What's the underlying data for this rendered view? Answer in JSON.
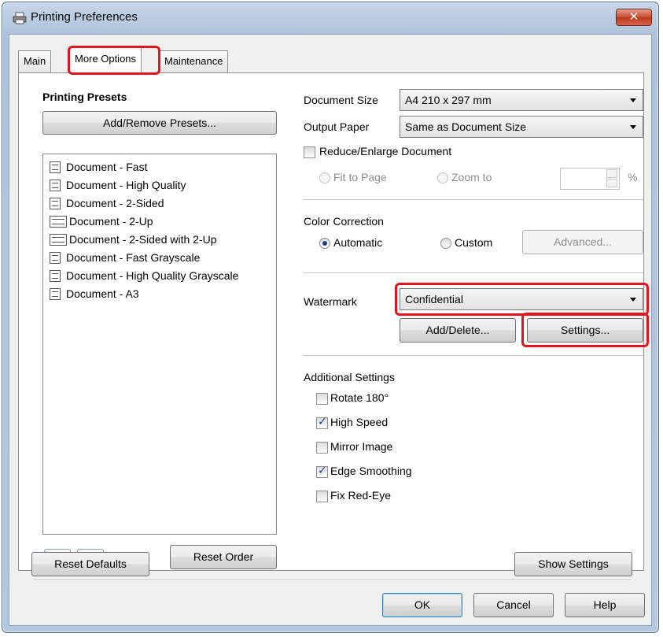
{
  "window": {
    "title": "Printing Preferences",
    "close_glyph": "✕"
  },
  "tabs": [
    {
      "label": "Main"
    },
    {
      "label": "More Options"
    },
    {
      "label": "Maintenance"
    }
  ],
  "presets": {
    "heading": "Printing Presets",
    "add_remove_label": "Add/Remove Presets...",
    "items": [
      {
        "label": "Document - Fast",
        "icon": "document-icon"
      },
      {
        "label": "Document - High Quality",
        "icon": "document-icon"
      },
      {
        "label": "Document - 2-Sided",
        "icon": "document-icon"
      },
      {
        "label": "Document - 2-Up",
        "icon": "two-up-icon"
      },
      {
        "label": "Document - 2-Sided with 2-Up",
        "icon": "two-up-icon"
      },
      {
        "label": "Document - Fast Grayscale",
        "icon": "document-icon"
      },
      {
        "label": "Document - High Quality Grayscale",
        "icon": "document-icon"
      },
      {
        "label": "Document - A3",
        "icon": "document-icon"
      }
    ],
    "reset_order_label": "Reset Order"
  },
  "document": {
    "size_label": "Document Size",
    "size_value": "A4 210 x 297 mm",
    "output_label": "Output Paper",
    "output_value": "Same as Document Size",
    "reduce_label": "Reduce/Enlarge Document",
    "reduce_checked": false,
    "fit_label": "Fit to Page",
    "zoom_label": "Zoom to",
    "percent": "%"
  },
  "color": {
    "label": "Color Correction",
    "automatic_label": "Automatic",
    "custom_label": "Custom",
    "advanced_label": "Advanced...",
    "selected": "Automatic"
  },
  "watermark": {
    "label": "Watermark",
    "value": "Confidential",
    "add_delete_label": "Add/Delete...",
    "settings_label": "Settings..."
  },
  "additional": {
    "label": "Additional Settings",
    "items": [
      {
        "label": "Rotate 180°",
        "checked": false
      },
      {
        "label": "High Speed",
        "checked": true
      },
      {
        "label": "Mirror Image",
        "checked": false
      },
      {
        "label": "Edge Smoothing",
        "checked": true
      },
      {
        "label": "Fix Red-Eye",
        "checked": false
      }
    ]
  },
  "footer": {
    "reset_defaults_label": "Reset Defaults",
    "show_settings_label": "Show Settings",
    "ok_label": "OK",
    "cancel_label": "Cancel",
    "help_label": "Help"
  },
  "highlight_color": "#e3141c"
}
